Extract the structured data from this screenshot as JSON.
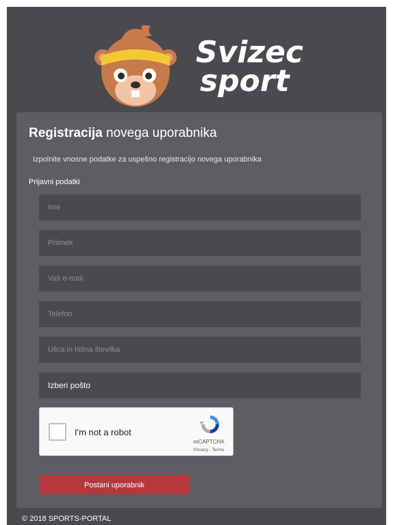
{
  "brand": {
    "line1": "Svizec",
    "line2": "sport"
  },
  "form": {
    "title_bold": "Registracija",
    "title_rest": "novega uporabnika",
    "subtitle": "Izpolnite vnosne podatke za uspešno registracijo novega uporabnika",
    "section_label": "Prijavni podatki",
    "fields": {
      "first_name": "Ime",
      "last_name": "Priimek",
      "email": "Vaš e-mail",
      "phone": "Telefon",
      "street": "Ulica in hišna številka"
    },
    "post_select": "Izberi pošto",
    "submit_label": "Postani uporabnik"
  },
  "captcha": {
    "label": "I'm not a robot",
    "brand": "reCAPTCHA",
    "links": "Privacy - Terms"
  },
  "footer": {
    "copyright": "© 2018 SPORTS-PORTAL"
  },
  "colors": {
    "background": "#4a494e",
    "panel": "#5e5d63",
    "accent": "#b5383d"
  }
}
